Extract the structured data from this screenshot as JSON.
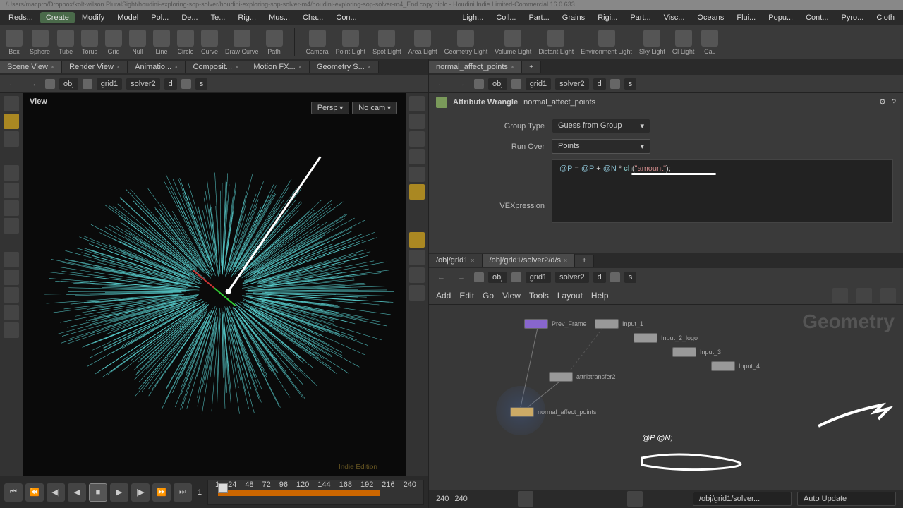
{
  "titlebar": "/Users/macpro/Dropbox/kolt-wilson PluralSight/houdini-exploring-sop-solver/houdini-exploring-sop-solver-m4/houdini-exploring-sop-solver-m4_End copy.hiplc - Houdini Indie Limited-Commercial 16.0.633",
  "menus": [
    "Reds...",
    "Create",
    "Modify",
    "Model",
    "Pol...",
    "De...",
    "Te...",
    "Rig...",
    "Mus...",
    "Cha...",
    "Con..."
  ],
  "menus2": [
    "Ligh...",
    "Coll...",
    "Part...",
    "Grains",
    "Rigi...",
    "Part...",
    "Visc...",
    "Oceans",
    "Flui...",
    "Popu...",
    "Cont...",
    "Pyro...",
    "Cloth"
  ],
  "shelf1": [
    {
      "n": "Box"
    },
    {
      "n": "Sphere"
    },
    {
      "n": "Tube"
    },
    {
      "n": "Torus"
    },
    {
      "n": "Grid"
    },
    {
      "n": "Null"
    },
    {
      "n": "Line"
    },
    {
      "n": "Circle"
    },
    {
      "n": "Curve"
    },
    {
      "n": "Draw Curve"
    },
    {
      "n": "Path"
    }
  ],
  "shelf2": [
    {
      "n": "Camera"
    },
    {
      "n": "Point Light"
    },
    {
      "n": "Spot Light"
    },
    {
      "n": "Area Light"
    },
    {
      "n": "Geometry Light"
    },
    {
      "n": "Volume Light"
    },
    {
      "n": "Distant Light"
    },
    {
      "n": "Environment Light"
    },
    {
      "n": "Sky Light"
    },
    {
      "n": "GI Light"
    },
    {
      "n": "Cau"
    }
  ],
  "left_tabs": [
    "Scene View",
    "Render View",
    "Animatio...",
    "Composit...",
    "Motion FX...",
    "Geometry S..."
  ],
  "path": {
    "segs": [
      "obj",
      "grid1",
      "solver2",
      "d",
      "s"
    ]
  },
  "viewport": {
    "label": "View",
    "persp": "Persp",
    "cam": "No cam",
    "watermark": "Indie Edition"
  },
  "timeline": {
    "current": "1",
    "end": "240",
    "ticks": [
      "1",
      "24",
      "48",
      "72",
      "96",
      "120",
      "144",
      "168",
      "192",
      "216",
      "240"
    ]
  },
  "param": {
    "tab": "normal_affect_points",
    "type": "Attribute Wrangle",
    "name": "normal_affect_points",
    "group_type_label": "Group Type",
    "group_type": "Guess from Group",
    "run_over_label": "Run Over",
    "run_over": "Points",
    "vex_label": "VEXpression",
    "code": "@P = @P + @N * ch(\"amount\");"
  },
  "net_tabs": [
    "/obj/grid1",
    "/obj/grid1/solver2/d/s"
  ],
  "net_menus": [
    "Add",
    "Edit",
    "Go",
    "View",
    "Tools",
    "Layout",
    "Help"
  ],
  "net_context": "Geometry",
  "nodes": {
    "prev": "Prev_Frame",
    "in1": "Input_1",
    "in2": "Input_2_logo",
    "in3": "Input_3",
    "in4": "Input_4",
    "attr": "attribtransfer2",
    "wrangle": "normal_affect_points"
  },
  "annot": "@P @N;",
  "status": {
    "path": "/obj/grid1/solver...",
    "mode": "Auto Update"
  }
}
